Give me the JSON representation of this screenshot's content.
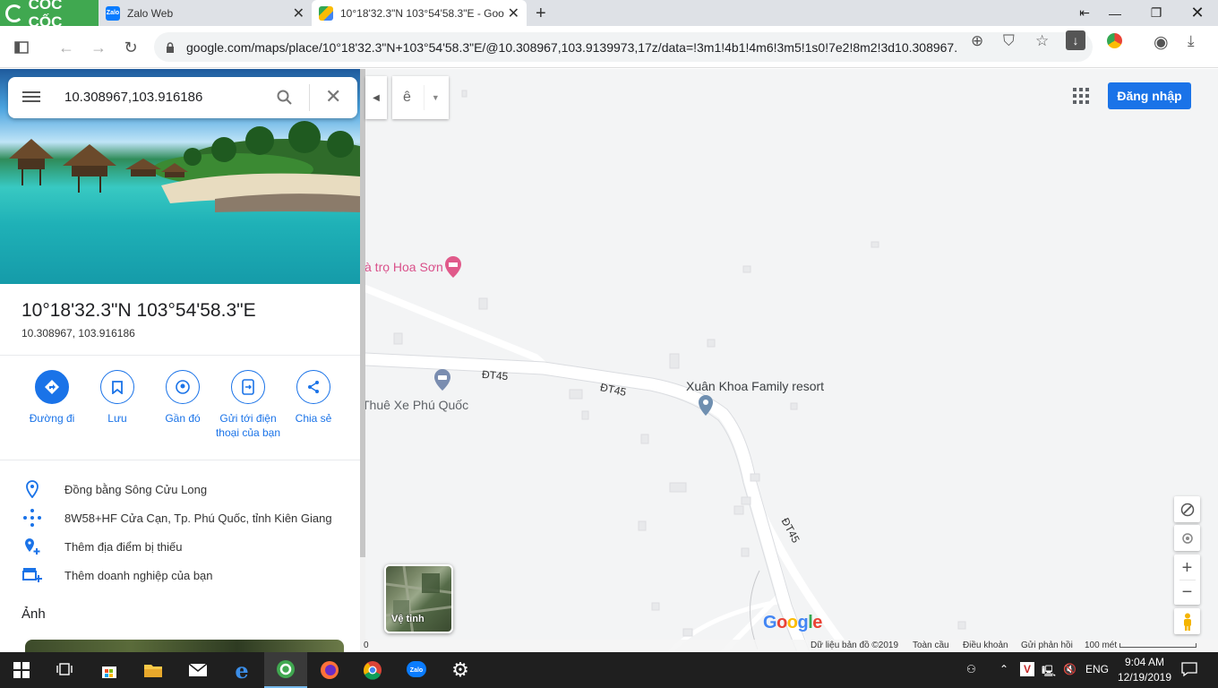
{
  "browser": {
    "brand": "CỐC CỐC",
    "tabs": [
      {
        "title": "Zalo Web"
      },
      {
        "title": "10°18'32.3\"N 103°54'58.3\"E - Goo"
      }
    ],
    "url": "google.com/maps/place/10°18'32.3\"N+103°54'58.3\"E/@10.308967,103.9139973,17z/data=!3m1!4b1!4m6!3m5!1s0!7e2!8m2!3d10.308967..."
  },
  "panel": {
    "search_value": "10.308967,103.916186",
    "title": "10°18'32.3\"N 103°54'58.3\"E",
    "subtitle": "10.308967, 103.916186",
    "actions": [
      {
        "label": "Đường đi",
        "icon": "directions-icon"
      },
      {
        "label": "Lưu",
        "icon": "bookmark-icon"
      },
      {
        "label": "Gần đó",
        "icon": "nearby-icon"
      },
      {
        "label": "Gửi tới điện thoại của bạn",
        "icon": "send-to-phone-icon"
      },
      {
        "label": "Chia sẻ",
        "icon": "share-icon"
      }
    ],
    "info": [
      {
        "text": "Đồng bằng Sông Cửu Long",
        "icon": "location-pin-icon"
      },
      {
        "text": "8W58+HF Cửa Cạn, Tp. Phú Quốc, tỉnh Kiên Giang",
        "icon": "plus-code-icon"
      },
      {
        "text": "Thêm địa điểm bị thiếu",
        "icon": "add-place-icon"
      },
      {
        "text": "Thêm doanh nghiệp của bạn",
        "icon": "add-business-icon"
      }
    ],
    "photos_title": "Ảnh"
  },
  "map": {
    "login": "Đăng nhập",
    "layer_glyph": "ê",
    "places": [
      {
        "name": "à trọ Hoa Sơn",
        "color": "#d9508a"
      },
      {
        "name": "Xuân Khoa Family resort",
        "color": "#3c4043"
      },
      {
        "name": "Thuê Xe Phú Quốc",
        "color": "#5f6368"
      }
    ],
    "roads": [
      "ĐT45",
      "ĐT45",
      "ĐT45"
    ],
    "satellite_label": "Vệ tinh",
    "google_logo": "Google",
    "footer": {
      "copyright": "Dữ liệu bản đồ ©2019",
      "global": "Toàn cầu",
      "terms": "Điều khoản",
      "feedback": "Gửi phản hồi",
      "scale": "100 mét"
    },
    "footer_left_char": "0"
  },
  "taskbar": {
    "lang": "ENG",
    "time": "9:04 AM",
    "date": "12/19/2019"
  },
  "colors": {
    "accent": "#1a73e8",
    "brand_green": "#40a850",
    "taskbar": "#1f1f1f"
  }
}
